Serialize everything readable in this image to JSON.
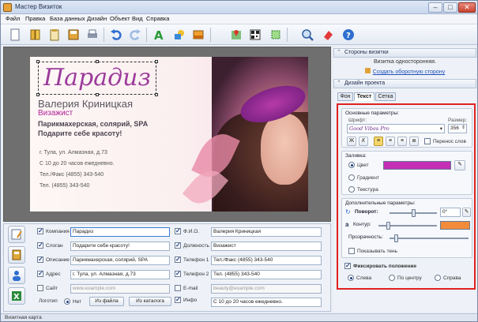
{
  "window": {
    "title": "Мастер Визиток",
    "min": "–",
    "max": "□",
    "close": "✕"
  },
  "menu": [
    "Файл",
    "Правка",
    "База данных",
    "Дизайн",
    "Объект",
    "Вид",
    "Справка"
  ],
  "card": {
    "title": "Парадиз",
    "name": "Валерия Криницкая",
    "position": "Визажист",
    "description": "Парикмахерская, солярий, SPA",
    "slogan": "Подарите себе красоту!",
    "address": "г. Тула, ул. Алмазная, д.73",
    "hours": "С 10 до 20 часов ежедневно.",
    "phone1": "Тел./Факс (4855) 343-540",
    "phone2": "Тел. (4855) 343-540"
  },
  "form": {
    "company_label": "Компания",
    "company_value": "Парадиз",
    "slogan_label": "Слоган",
    "slogan_value": "Подарите себе красоту!",
    "description_label": "Описание",
    "description_value": "Парикмахерская, солярий, SPA",
    "address_label": "Адрес",
    "address_value": "г. Тула, ул. Алмазная, д.73",
    "site_label": "Сайт",
    "site_placeholder": "www.example.com",
    "fio_label": "Ф.И.О.",
    "fio_value": "Валерия Криницкая",
    "post_label": "Должность",
    "post_value": "Визажист",
    "phone1_label": "Телефон 1",
    "phone1_value": "Тел./Факс (4855) 343-540",
    "phone2_label": "Телефон 2",
    "phone2_value": "Тел. (4855) 343-540",
    "email_label": "E-mail",
    "email_placeholder": "beauty@example.com",
    "info_label": "Инфо",
    "info_value": "С 10 до 20 часов ежедневно.",
    "logo_label": "Логотип",
    "logo_none": "Нет",
    "logo_file": "Из файла",
    "logo_catalog": "Из каталога"
  },
  "status": {
    "text": "Визитная карта"
  },
  "right": {
    "sides_header": "Стороны визитки",
    "sides_info": "Визитка односторонняя.",
    "sides_link": "Создать оборотную сторону",
    "design_header": "Дизайн проекта",
    "tabs": [
      "Фон",
      "Текст",
      "Сетка"
    ],
    "basic_group": "Основные параметры:",
    "font_label": "Шрифт:",
    "font_value": "Good Vibes Pro",
    "size_label": "Размер:",
    "size_value": "356",
    "wrap_label": "Перенос слов",
    "fill_group": "Заливка:",
    "fill_color": "Цвет",
    "fill_gradient": "Градиент",
    "fill_texture": "Текстура",
    "fill_swatch": "#c42fb5",
    "extra_group": "Дополнительные параметры:",
    "rotate_label": "Поворот:",
    "rotate_value": "0°",
    "outline_label": "Контур:",
    "outline_swatch": "#f28c3a",
    "opacity_label": "Прозрачность:",
    "shadow_label": "Показывать тень",
    "fix_label": "Фиксировать положение",
    "align_left": "Слева",
    "align_center": "По центру",
    "align_right": "Справа"
  }
}
